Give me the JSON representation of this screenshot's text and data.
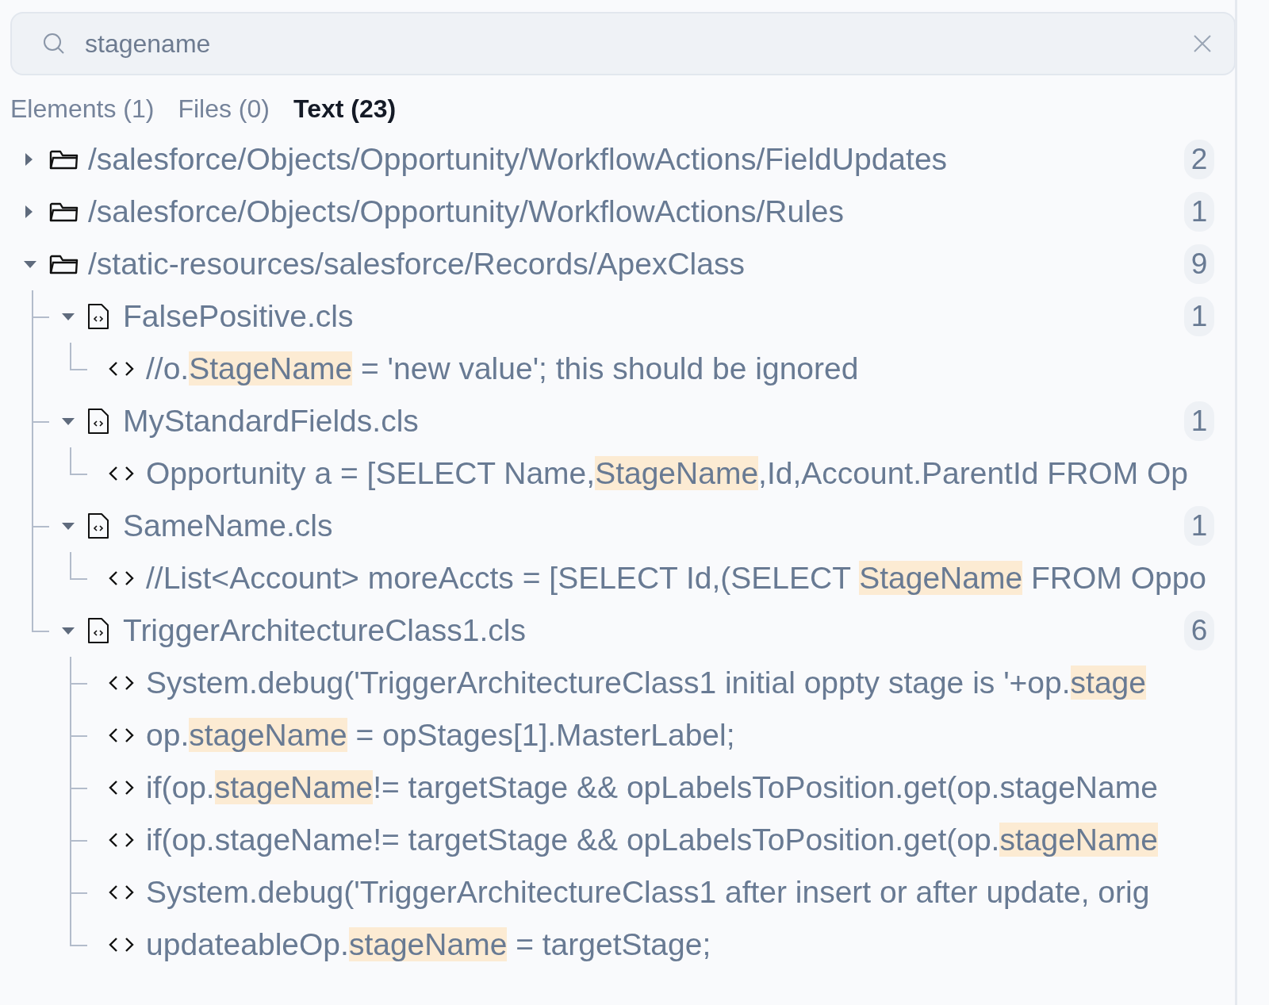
{
  "search": {
    "value": "stagename"
  },
  "tabs": [
    {
      "label": "Elements (1)",
      "selected": false
    },
    {
      "label": "Files (0)",
      "selected": false
    },
    {
      "label": "Text (23)",
      "selected": true
    }
  ],
  "tree": [
    {
      "kind": "folder",
      "label": "/salesforce/Objects/Opportunity/WorkflowActions/FieldUpdates",
      "expanded": false,
      "count": "2"
    },
    {
      "kind": "folder",
      "label": "/salesforce/Objects/Opportunity/WorkflowActions/Rules",
      "expanded": false,
      "count": "1"
    },
    {
      "kind": "folder",
      "label": "/static-resources/salesforce/Records/ApexClass",
      "expanded": true,
      "count": "9",
      "children": [
        {
          "kind": "file",
          "label": "FalsePositive.cls",
          "expanded": true,
          "count": "1",
          "children": [
            {
              "kind": "match",
              "segments": [
                {
                  "text": "//o.",
                  "highlighted": false
                },
                {
                  "text": "StageName",
                  "highlighted": true
                },
                {
                  "text": " = 'new value'; this should be ignored",
                  "highlighted": false
                }
              ]
            }
          ]
        },
        {
          "kind": "file",
          "label": "MyStandardFields.cls",
          "expanded": true,
          "count": "1",
          "children": [
            {
              "kind": "match",
              "segments": [
                {
                  "text": "Opportunity a = [SELECT Name,",
                  "highlighted": false
                },
                {
                  "text": "StageName",
                  "highlighted": true
                },
                {
                  "text": ",Id,Account.ParentId FROM Op",
                  "highlighted": false
                }
              ]
            }
          ]
        },
        {
          "kind": "file",
          "label": "SameName.cls",
          "expanded": true,
          "count": "1",
          "children": [
            {
              "kind": "match",
              "segments": [
                {
                  "text": "//List<Account> moreAccts = [SELECT Id,(SELECT ",
                  "highlighted": false
                },
                {
                  "text": "StageName",
                  "highlighted": true
                },
                {
                  "text": " FROM Oppo",
                  "highlighted": false
                }
              ]
            }
          ]
        },
        {
          "kind": "file",
          "label": "TriggerArchitectureClass1.cls",
          "expanded": true,
          "count": "6",
          "children": [
            {
              "kind": "match",
              "segments": [
                {
                  "text": "System.debug('TriggerArchitectureClass1 initial oppty stage is '+op.",
                  "highlighted": false
                },
                {
                  "text": "stage",
                  "highlighted": true
                }
              ]
            },
            {
              "kind": "match",
              "segments": [
                {
                  "text": "op.",
                  "highlighted": false
                },
                {
                  "text": "stageName",
                  "highlighted": true
                },
                {
                  "text": " = opStages[1].MasterLabel;",
                  "highlighted": false
                }
              ]
            },
            {
              "kind": "match",
              "segments": [
                {
                  "text": "if(op.",
                  "highlighted": false
                },
                {
                  "text": "stageName",
                  "highlighted": true
                },
                {
                  "text": "!= targetStage && opLabelsToPosition.get(op.stageName",
                  "highlighted": false
                }
              ]
            },
            {
              "kind": "match",
              "segments": [
                {
                  "text": "if(op.stageName!= targetStage && opLabelsToPosition.get(op.",
                  "highlighted": false
                },
                {
                  "text": "stageName",
                  "highlighted": true
                }
              ]
            },
            {
              "kind": "match",
              "segments": [
                {
                  "text": "System.debug('TriggerArchitectureClass1 after insert or after update, orig",
                  "highlighted": false
                }
              ]
            },
            {
              "kind": "match",
              "segments": [
                {
                  "text": "updateableOp.",
                  "highlighted": false
                },
                {
                  "text": "stageName",
                  "highlighted": true
                },
                {
                  "text": " = targetStage;",
                  "highlighted": false
                }
              ]
            }
          ]
        }
      ]
    }
  ]
}
